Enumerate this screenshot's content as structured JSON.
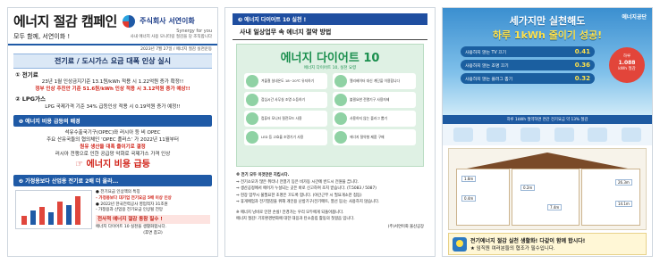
{
  "page1": {
    "title": "에너지 절감 캠페인",
    "subtitle": "모두 함께, 서연이화 !",
    "company": "주식회사 서연이화",
    "company_tagline": "Synergy for you",
    "company_tagline2": "사내 에너지 사용 모니터링 절감을 당 조직합니다",
    "date_line": "2023년 7월 27일 / 에너지 절감 실천운동",
    "section_title": "전기료 / 도시가스 요금 대폭 인상 실시",
    "electric_head": "① 전기료",
    "electric_line1": "23년 1월 인상금지기준 13.1원/kWh 적용 시 1.22억원 증가 확정!!",
    "electric_line2": "정부 인상 추진안 기준 51.6원/kWh 인상 적용 시 3.12억원 증가 예상!!",
    "lpg_head": "② LPG가스",
    "lpg_line": "LPG 국제가격 기준 34% 급등인상 적용 시 0.19억원 증가 예정!!",
    "band1": "❶ 에너지 비용 급등의 배경",
    "bg_line1": "석유수출국기구(OPEC)와 러시아 등 비 OPEC",
    "bg_line2": "주요 산유국들의 협의체인 ‘OPEC 플러스’ 가 2022년 11월부터",
    "bg_line3": "원유 생산을 대폭 줄이기로 결정",
    "bg_line4": "러시아 전쟁으로 인한 공급망 악화로 국제가스 가격 인상",
    "big_red": "☞ 에너지 비용 급등",
    "band2": "❷ 가정용보다 산업용 전기료 2배 더 올라...",
    "note1": "● 전기요금 인상액의 특징",
    "note2": "- 가정용보다 대기업 전기요금 5배 이상 인상",
    "note3": "● 2022년 한국전력공사 영업적자 31조원",
    "note4": "- 가정용과 산업용 전기요금 인상될 전망",
    "pink": "전사적 에너지 절감 동참 필수 !",
    "note5": "에너지 다이어트 10 실천을 생활화합시다.",
    "note6": "(후면 참고)"
  },
  "page2": {
    "badge": "❸ 에너지 다이어트 10 실천 !",
    "subtitle": "사내 일상업무 속 에너지 절약 방법",
    "poster_title": "에너지 다이어트 10",
    "poster_sub": "에너지 다이어트 10, 실천 요령",
    "items": [
      "겨울철 실내온도 18~20℃ 유지하기",
      "엘리베이터 대신 계단을 이용합니다",
      "점심시간 사무실 조명 소등하기",
      "불필요한 전열기구 사용자제",
      "컴퓨터 모니터 절전모드 사용",
      "사용하지 않는 플러그 뽑기",
      "LED 등 고효율 조명기기 사용",
      "에너지 절약형 제품 구매"
    ],
    "rules": [
      "※ 전기 모두 이것만은 지킵시다.",
      "⇒ 전기소모가 많은 취터나 전열기 등은 비가동 시간에 반드시 전원을 끕니다.",
      "⇒ 생산공정에서 에어가 누설되는 곳은 바로 신고하여 조치 받습니다. (T.5083 / 5087)",
      "⇒ 현장 업무시 불필요한 조명은 끄도록 합니다. (야간근무 시 필요개소만 점등)",
      "⇒ 휴게에업과 전기열감을 위해 개인용 난방기구(전기매트, 열선 등)는 사용하지 않습니다."
    ],
    "foot1": "※ 에너지 낭비로 인한 손실! 안경가는 우리 모두에게 되돌아옵니다.",
    "foot2": "에너지 절감! 기후환경변화에 대한 대응과 탄소중립 활동의 첫걸음 입니다.",
    "signature": "(주)서연이화 울산공장"
  },
  "page3": {
    "logo": "에너지공단",
    "headline1": "세가지만 실천해도",
    "headline2": "하루 1kWh 줄이기 성공!",
    "rows": [
      {
        "label": "사용하지 않는 TV 끄기",
        "value": "0.41"
      },
      {
        "label": "사용하지 않는 조명 끄기",
        "value": "0.36"
      },
      {
        "label": "사용하지 않는 플러그 뽑기",
        "value": "0.32"
      }
    ],
    "bubble_top": "하루",
    "bubble_value": "1.088",
    "bubble_unit": "kWh 절감",
    "stripe": "하루 1kWh 절약하면 연간 전기요금 약 13% 절감",
    "house_tags": [
      "1.8m",
      "0.4m",
      "0.2m",
      "7.4m",
      "26.3m",
      "14.1m"
    ],
    "bottom_line1": "전기에너지 절감 실천 생활화! 다같이 함께 합시다!",
    "bottom_line2": "★ 임직원 여러분들의 협조가 필수입니다."
  },
  "colors": {
    "brand_blue": "#1f5aa6",
    "alert_red": "#d1241a",
    "poster_green": "#1b8f4e"
  }
}
